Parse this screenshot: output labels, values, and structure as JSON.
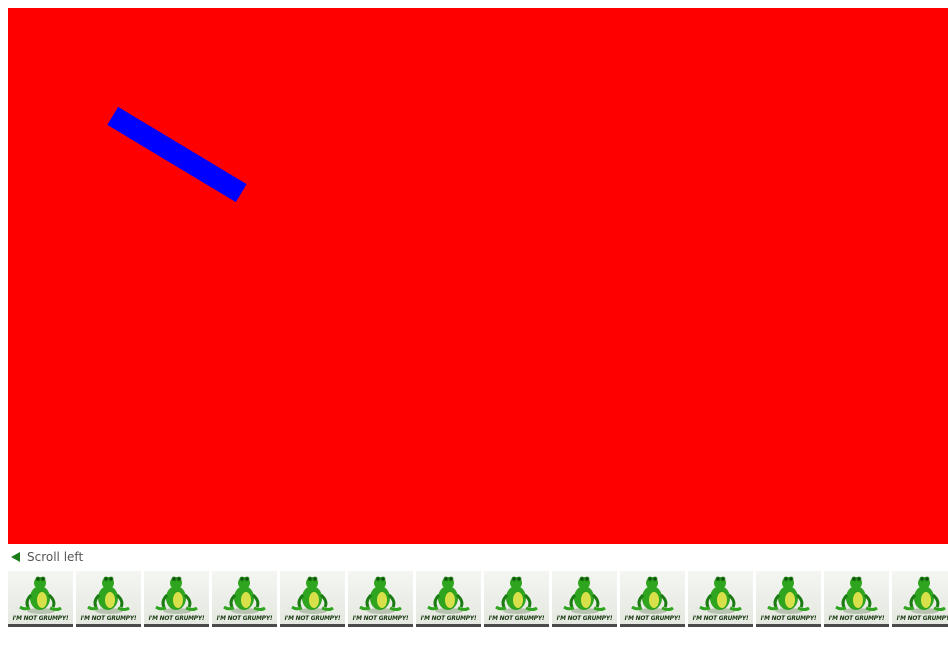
{
  "stage": {
    "background_color": "#ff0000",
    "bar_color": "#0000ff"
  },
  "scroll_left": {
    "label": "Scroll left",
    "arrow_color": "#1a7f1a"
  },
  "thumbnails": {
    "count": 14,
    "icon": "frog-icon",
    "caption": "I'M NOT GRUMPY!"
  }
}
